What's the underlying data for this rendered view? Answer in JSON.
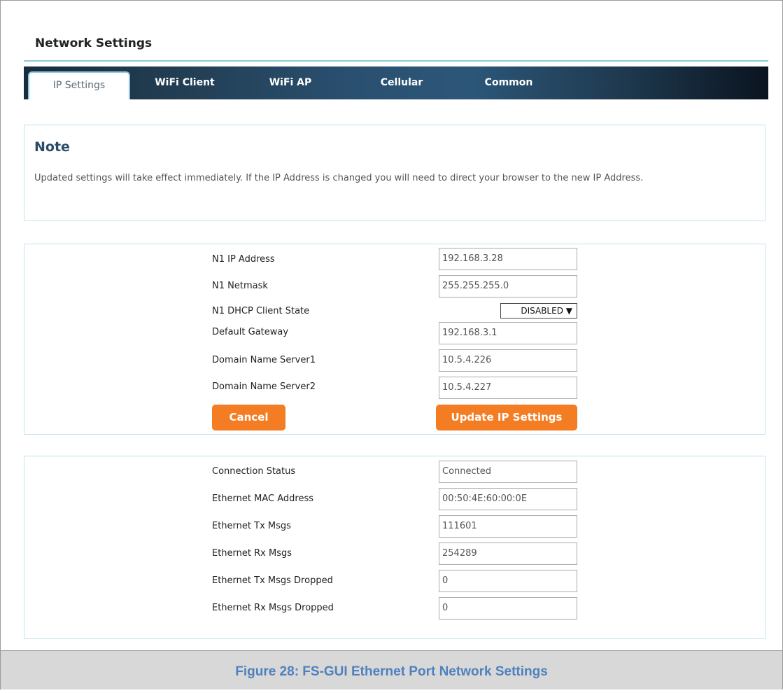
{
  "page": {
    "title": "Network Settings"
  },
  "tabs": [
    {
      "label": "IP Settings"
    },
    {
      "label": "WiFi Client"
    },
    {
      "label": "WiFi AP"
    },
    {
      "label": "Cellular"
    },
    {
      "label": "Common"
    }
  ],
  "note": {
    "title": "Note",
    "text": "Updated settings will take effect immediately. If the IP Address is changed you will need to direct your browser to the new IP Address."
  },
  "ip_settings": {
    "ip_address": {
      "label": "N1 IP Address",
      "value": "192.168.3.28"
    },
    "netmask": {
      "label": "N1 Netmask",
      "value": "255.255.255.0"
    },
    "dhcp": {
      "label": "N1 DHCP Client State",
      "value": "DISABLED ▼"
    },
    "gateway": {
      "label": "Default Gateway",
      "value": "192.168.3.1"
    },
    "dns1": {
      "label": "Domain Name Server1",
      "value": "10.5.4.226"
    },
    "dns2": {
      "label": "Domain Name Server2",
      "value": "10.5.4.227"
    },
    "cancel_label": "Cancel",
    "update_label": "Update IP Settings"
  },
  "status": {
    "connection": {
      "label": "Connection Status",
      "value": "Connected"
    },
    "mac": {
      "label": "Ethernet MAC Address",
      "value": "00:50:4E:60:00:0E"
    },
    "tx": {
      "label": "Ethernet Tx Msgs",
      "value": "111601"
    },
    "rx": {
      "label": "Ethernet Rx Msgs",
      "value": "254289"
    },
    "tx_dropped": {
      "label": "Ethernet Tx Msgs Dropped",
      "value": "0"
    },
    "rx_dropped": {
      "label": "Ethernet Rx Msgs Dropped",
      "value": "0"
    }
  },
  "caption": "Figure 28: FS-GUI Ethernet Port Network Settings",
  "colors": {
    "accent": "#f47c22",
    "tab_bar": "#2a5071",
    "caption": "#4f81bd"
  }
}
